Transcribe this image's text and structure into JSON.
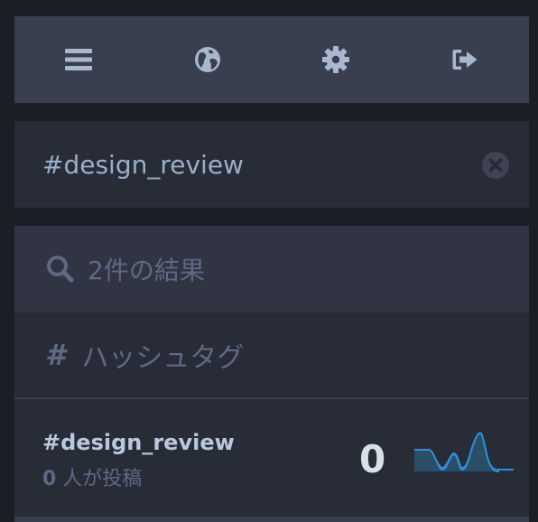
{
  "nav": {
    "items": [
      {
        "name": "menu",
        "icon": "bars-icon"
      },
      {
        "name": "explore",
        "icon": "globe-icon"
      },
      {
        "name": "preferences",
        "icon": "gear-icon"
      },
      {
        "name": "logout",
        "icon": "sign-out-icon"
      }
    ]
  },
  "search": {
    "value": "#design_review",
    "clear_icon": "times-circle-icon"
  },
  "results": {
    "count_label": "2件の結果",
    "section_title": "ハッシュタグ",
    "section_icon": "#",
    "hashtag": {
      "name": "#design_review",
      "people_count": "0",
      "people_suffix": " 人が投稿",
      "uses": "0"
    }
  },
  "colors": {
    "background": "#1c1e26",
    "navbar": "#393f4f",
    "panel": "#282c37",
    "muted_text": "#606984",
    "accent": "#2b90d9"
  }
}
